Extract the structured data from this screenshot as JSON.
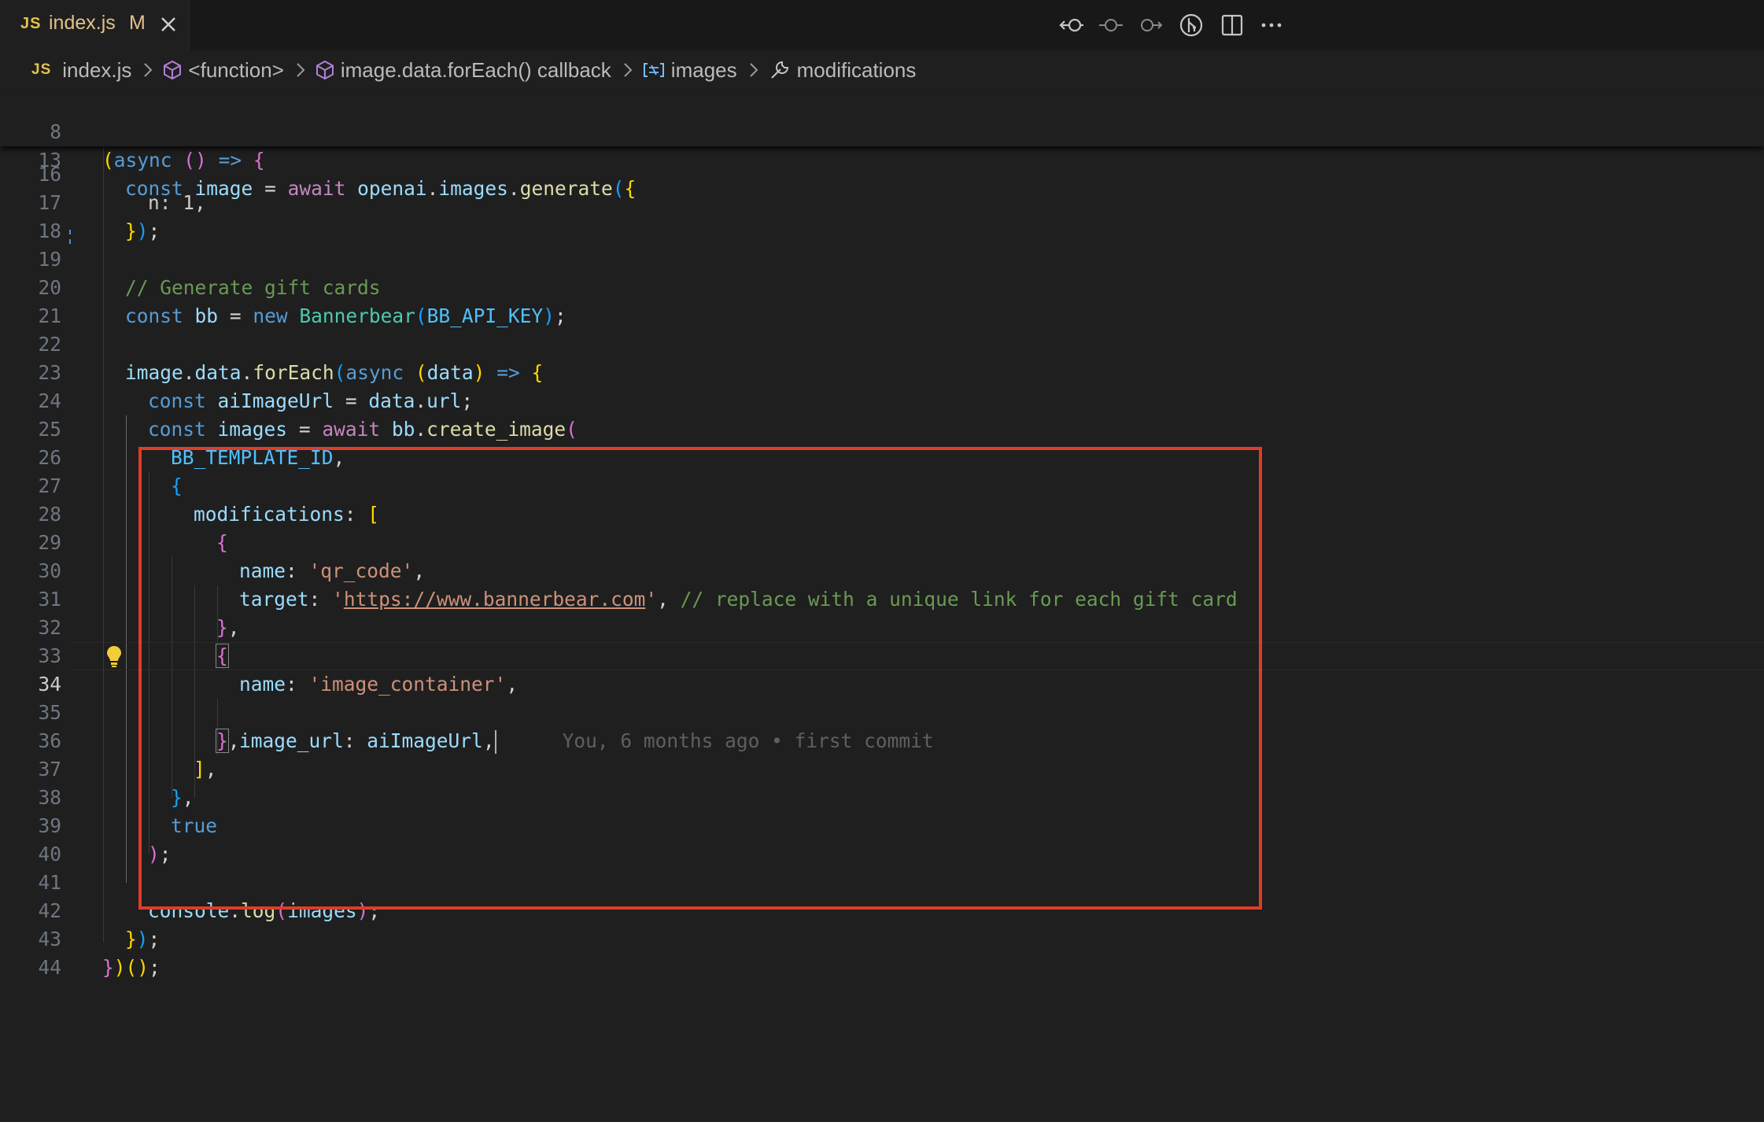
{
  "tab": {
    "badge": "JS",
    "file_name": "index.js",
    "status": "M"
  },
  "actions": [
    "open-changes-icon",
    "previous-change-icon",
    "next-change-icon",
    "git-graph-icon",
    "split-editor-icon",
    "more-actions-icon"
  ],
  "breadcrumb": {
    "file": "index.js",
    "function": "<function>",
    "callback": "image.data.forEach() callback",
    "variable": "images",
    "property": "modifications"
  },
  "sticky": [
    {
      "ln": "8"
    },
    {
      "ln": "13"
    }
  ],
  "lines": [
    {
      "ln": "17"
    },
    {
      "ln": "18"
    },
    {
      "ln": "19"
    },
    {
      "ln": "20"
    },
    {
      "ln": "21"
    },
    {
      "ln": "22"
    },
    {
      "ln": "23"
    },
    {
      "ln": "24"
    },
    {
      "ln": "25"
    },
    {
      "ln": "26"
    },
    {
      "ln": "27"
    },
    {
      "ln": "28"
    },
    {
      "ln": "29"
    },
    {
      "ln": "30"
    },
    {
      "ln": "31"
    },
    {
      "ln": "32"
    },
    {
      "ln": "33"
    },
    {
      "ln": "34"
    },
    {
      "ln": "35"
    },
    {
      "ln": "36"
    },
    {
      "ln": "37"
    },
    {
      "ln": "38"
    },
    {
      "ln": "39"
    },
    {
      "ln": "40"
    },
    {
      "ln": "41"
    },
    {
      "ln": "42"
    },
    {
      "ln": "43"
    },
    {
      "ln": "44"
    }
  ],
  "partial_line": {
    "ln": "16",
    "text": "n: 1,"
  },
  "code": {
    "async": "async",
    "const": "const",
    "await": "await",
    "new": "new",
    "true": "true",
    "image": "image",
    "openai": "openai",
    "images_prop": "images",
    "generate": "generate",
    "comment_gift": "// Generate gift cards",
    "bb": "bb",
    "bannerbear": "Bannerbear",
    "bb_api_key": "BB_API_KEY",
    "data": "data",
    "foreach": "forEach",
    "ai_image_url": "aiImageUrl",
    "url": "url",
    "images": "images",
    "create_image": "create_image",
    "bb_template_id": "BB_TEMPLATE_ID",
    "modifications": "modifications",
    "name": "name",
    "target": "target",
    "image_url": "image_url",
    "str_qr_code": "'qr_code'",
    "str_url": "https://www.bannerbear.com",
    "comment_replace": "// replace with a unique link for each gift card",
    "str_image_container": "'image_container'",
    "console": "console",
    "log": "log",
    "blame": "You, 6 months ago • first commit"
  },
  "colors": {
    "highlight_box": "#e03c28",
    "editor_bg": "#1f1f1f",
    "tab_modified": "#e2c08d"
  }
}
